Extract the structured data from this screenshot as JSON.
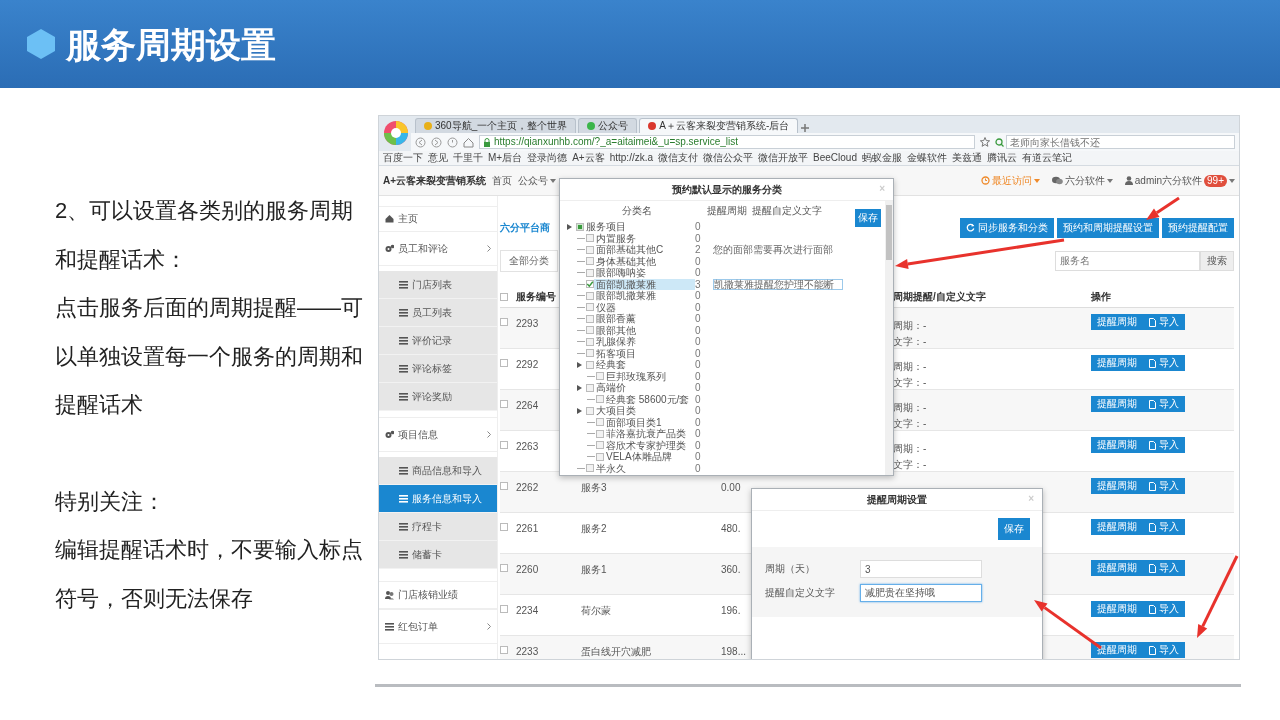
{
  "slide": {
    "title": "服务周期设置",
    "notes": [
      [
        "2、可以设置各类别的服务周期和提醒话术：",
        "点击服务后面的周期提醒——可以单独设置每一个服务的周期和提醒话术"
      ],
      [
        "特别关注：",
        "编辑提醒话术时，不要输入标点符号，否则无法保存"
      ]
    ]
  },
  "browser": {
    "tabs": [
      {
        "label": "360导航_一个主页，整个世界",
        "selected": false,
        "color": "#e8b019"
      },
      {
        "label": "公众号",
        "selected": false,
        "color": "#3bb54a"
      },
      {
        "label": "A＋云客来裂变营销系统-后台",
        "selected": true,
        "color": "#d9382e"
      }
    ],
    "url": "https://qianxunhb.com/?_a=aitaimei&_u=sp.service_list",
    "search_placeholder": "老师向家长借钱不还",
    "bookmarks": [
      "百度一下",
      "意见",
      "千里千",
      "M+后台",
      "登录尚德",
      "A+云客",
      "http://zk.a",
      "微信支付",
      "微信公众平",
      "微信开放平",
      "BeeCloud",
      "蚂蚁金服",
      "金蝶软件",
      "美兹通",
      "腾讯云",
      "有道云笔记"
    ]
  },
  "navbar": {
    "brand": "A+云客来裂变营销系统",
    "links": [
      {
        "label": "首页",
        "kind": "plain"
      },
      {
        "label": "公众号",
        "kind": "dropdown"
      }
    ],
    "recent": "最近访问",
    "company": "六分软件",
    "user": "admin六分软件",
    "badge": "99+"
  },
  "sidebar": [
    {
      "label": "主页",
      "kind": "home",
      "selected": false
    },
    {
      "label": "员工和评论",
      "kind": "section",
      "selected": false
    },
    {
      "label": "门店列表",
      "kind": "sub",
      "selected": false
    },
    {
      "label": "员工列表",
      "kind": "sub",
      "selected": false
    },
    {
      "label": "评价记录",
      "kind": "sub",
      "selected": false
    },
    {
      "label": "评论标签",
      "kind": "sub",
      "selected": false
    },
    {
      "label": "评论奖励",
      "kind": "sub",
      "selected": false
    },
    {
      "label": "项目信息",
      "kind": "section",
      "selected": false
    },
    {
      "label": "商品信息和导入",
      "kind": "sub",
      "selected": false
    },
    {
      "label": "服务信息和导入",
      "kind": "sub",
      "selected": true
    },
    {
      "label": "疗程卡",
      "kind": "sub",
      "selected": false
    },
    {
      "label": "储蓄卡",
      "kind": "sub",
      "selected": false
    },
    {
      "label": "门店核销业绩",
      "kind": "users",
      "selected": false
    },
    {
      "label": "红包订单",
      "kind": "list-section",
      "selected": false
    }
  ],
  "main": {
    "title": "六分平台商",
    "select_all_checked": false,
    "buttons": [
      {
        "label": "同步服务和分类",
        "kind": "sync"
      },
      {
        "label": "预约和周期提醒设置",
        "kind": "plain"
      },
      {
        "label": "预约提醒配置",
        "kind": "plain"
      }
    ],
    "filter": "全部分类",
    "search_placeholder": "服务名",
    "search_button": "搜索",
    "columns": {
      "id": "服务编号",
      "reminder": "周期提醒/自定义文字",
      "actions": "操作"
    },
    "rows": [
      {
        "id": "2293",
        "checked": false,
        "reminder": [
          "周期：-",
          "文字：-"
        ],
        "actions": [
          {
            "label": "提醒周期",
            "kind": "plain"
          },
          {
            "label": "导入",
            "kind": "import"
          }
        ]
      },
      {
        "id": "2292",
        "checked": false,
        "reminder": [
          "周期：-",
          "文字：-"
        ],
        "actions": [
          {
            "label": "提醒周期",
            "kind": "plain"
          },
          {
            "label": "导入",
            "kind": "import"
          }
        ]
      },
      {
        "id": "2264",
        "checked": false,
        "reminder": [
          "周期：-",
          "文字：-"
        ],
        "actions": [
          {
            "label": "提醒周期",
            "kind": "plain"
          },
          {
            "label": "导入",
            "kind": "import"
          }
        ]
      },
      {
        "id": "2263",
        "checked": false,
        "reminder": [
          "周期：-",
          "文字：-"
        ],
        "actions": [
          {
            "label": "提醒周期",
            "kind": "plain"
          },
          {
            "label": "导入",
            "kind": "import"
          }
        ]
      },
      {
        "id": "2262",
        "checked": false,
        "name": "服务3",
        "price": "0.00",
        "actions": [
          {
            "label": "提醒周期",
            "kind": "plain"
          },
          {
            "label": "导入",
            "kind": "import"
          }
        ]
      },
      {
        "id": "2261",
        "checked": false,
        "name": "服务2",
        "price": "480.",
        "actions": [
          {
            "label": "提醒周期",
            "kind": "plain"
          },
          {
            "label": "导入",
            "kind": "import"
          }
        ]
      },
      {
        "id": "2260",
        "checked": false,
        "name": "服务1",
        "price": "360.",
        "actions": [
          {
            "label": "提醒周期",
            "kind": "plain"
          },
          {
            "label": "导入",
            "kind": "import"
          }
        ]
      },
      {
        "id": "2234",
        "checked": false,
        "name": "荷尔蒙",
        "price": "196.",
        "actions": [
          {
            "label": "提醒周期",
            "kind": "plain"
          },
          {
            "label": "导入",
            "kind": "import"
          }
        ]
      },
      {
        "id": "2233",
        "checked": false,
        "name": "蛋白线开穴减肥",
        "price": "198...",
        "actions": [
          {
            "label": "提醒周期",
            "kind": "plain"
          },
          {
            "label": "导入",
            "kind": "import"
          }
        ]
      }
    ]
  },
  "category_dialog": {
    "title": "预约默认显示的服务分类",
    "close": "×",
    "columns": [
      "分类名",
      "提醒周期",
      "提醒自定义文字"
    ],
    "save": "保存",
    "tree": [
      {
        "name": "服务项目",
        "period": "0",
        "checked": false,
        "partial": true,
        "selected": false,
        "children": [
          {
            "name": "内置服务",
            "period": "0",
            "checked": false,
            "partial": false,
            "selected": false
          },
          {
            "name": "面部基础其他C",
            "period": "2",
            "text": "您的面部需要再次进行面部",
            "checked": false,
            "partial": false,
            "selected": false
          },
          {
            "name": "身体基础其他",
            "period": "0",
            "checked": false,
            "partial": false,
            "selected": false
          },
          {
            "name": "眼部嗨呐姿",
            "period": "0",
            "checked": false,
            "partial": false,
            "selected": false
          },
          {
            "name": "面部凯撒莱雅",
            "period": "3",
            "text": "凯撒莱雅提醒您护理不能断",
            "checked": true,
            "partial": false,
            "selected": true
          },
          {
            "name": "眼部凯撒莱雅",
            "period": "0",
            "checked": false,
            "partial": false,
            "selected": false
          },
          {
            "name": "仪器",
            "period": "0",
            "checked": false,
            "partial": false,
            "selected": false
          },
          {
            "name": "眼部香薰",
            "period": "0",
            "checked": false,
            "partial": false,
            "selected": false
          },
          {
            "name": "眼部其他",
            "period": "0",
            "checked": false,
            "partial": false,
            "selected": false
          },
          {
            "name": "乳腺保养",
            "period": "0",
            "checked": false,
            "partial": false,
            "selected": false
          },
          {
            "name": "拓客项目",
            "period": "0",
            "checked": false,
            "partial": false,
            "selected": false
          },
          {
            "name": "经典套",
            "period": "0",
            "checked": false,
            "partial": false,
            "selected": false,
            "children": [
              {
                "name": "巨邦玫瑰系列",
                "period": "0",
                "checked": false,
                "partial": false,
                "selected": false
              }
            ]
          },
          {
            "name": "高端价",
            "period": "0",
            "checked": false,
            "partial": false,
            "selected": false,
            "children": [
              {
                "name": "经典套 58600元/套",
                "period": "0",
                "checked": false,
                "partial": false,
                "selected": false
              }
            ]
          },
          {
            "name": "大项目类",
            "period": "0",
            "checked": false,
            "partial": false,
            "selected": false,
            "children": [
              {
                "name": "面部项目类1",
                "period": "0",
                "checked": false,
                "partial": false,
                "selected": false
              },
              {
                "name": "菲洛嘉抗衰产品类",
                "period": "0",
                "checked": false,
                "partial": false,
                "selected": false
              },
              {
                "name": "容欣术专家护理类",
                "period": "0",
                "checked": false,
                "partial": false,
                "selected": false
              },
              {
                "name": "VELA体雕品牌",
                "period": "0",
                "checked": false,
                "partial": false,
                "selected": false
              }
            ]
          },
          {
            "name": "半永久",
            "period": "0",
            "checked": false,
            "partial": false,
            "selected": false
          }
        ]
      }
    ]
  },
  "period_dialog": {
    "title": "提醒周期设置",
    "close": "×",
    "save": "保存",
    "fields": [
      {
        "label": "周期（天）",
        "value": "3",
        "focused": false
      },
      {
        "label": "提醒自定义文字",
        "value": "减肥贵在坚持哦",
        "focused": true
      }
    ]
  }
}
